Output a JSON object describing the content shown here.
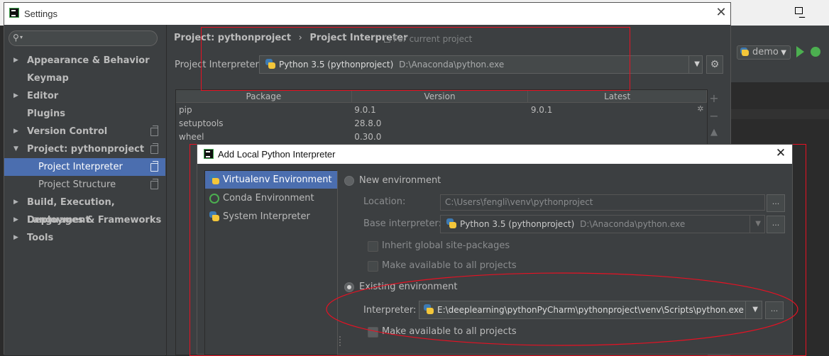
{
  "settings": {
    "window_title": "Settings",
    "search_placeholder": "",
    "nav": [
      {
        "label": "Appearance & Behavior",
        "expand": "▶"
      },
      {
        "label": "Keymap"
      },
      {
        "label": "Editor",
        "expand": "▶"
      },
      {
        "label": "Plugins"
      },
      {
        "label": "Version Control",
        "expand": "▶"
      },
      {
        "label": "Project: pythonproject",
        "expand": "▼"
      },
      {
        "label": "Project Interpreter"
      },
      {
        "label": "Project Structure"
      },
      {
        "label": "Build, Execution, Deployment",
        "expand": "▶"
      },
      {
        "label": "Languages & Frameworks",
        "expand": "▶"
      },
      {
        "label": "Tools",
        "expand": "▶"
      }
    ],
    "breadcrumb": {
      "project": "Project: pythonproject",
      "separator": "›",
      "page": "Project Interpreter",
      "scope": "For current project"
    },
    "interpreter": {
      "label": "Project Interpreter:",
      "name": "Python 3.5 (pythonproject)",
      "path": "D:\\Anaconda\\python.exe"
    },
    "packages": {
      "columns": [
        "Package",
        "Version",
        "Latest"
      ],
      "rows": [
        {
          "name": "pip",
          "version": "9.0.1",
          "latest": "9.0.1"
        },
        {
          "name": "setuptools",
          "version": "28.8.0",
          "latest": ""
        },
        {
          "name": "wheel",
          "version": "0.30.0",
          "latest": ""
        }
      ]
    }
  },
  "ide": {
    "run_config": "demo"
  },
  "dialog": {
    "title": "Add Local Python Interpreter",
    "env_types": [
      "Virtualenv Environment",
      "Conda Environment",
      "System Interpreter"
    ],
    "new_env": {
      "label": "New environment",
      "location_label": "Location:",
      "location_value": "C:\\Users\\fengli\\venv\\pythonproject",
      "base_label": "Base interpreter:",
      "base_name": "Python 3.5 (pythonproject)",
      "base_path": "D:\\Anaconda\\python.exe",
      "inherit_label": "Inherit global site-packages",
      "available_label": "Make available to all projects"
    },
    "existing_env": {
      "label": "Existing environment",
      "interpreter_label": "Interpreter:",
      "interpreter_value": "E:\\deeplearning\\pythonPyCharm\\pythonproject\\venv\\Scripts\\python.exe",
      "available_label": "Make available to all projects"
    },
    "ellipsis": "..."
  },
  "colors": {
    "selection": "#4b6eaf",
    "annotation": "#e81123",
    "background": "#3c3f41"
  }
}
